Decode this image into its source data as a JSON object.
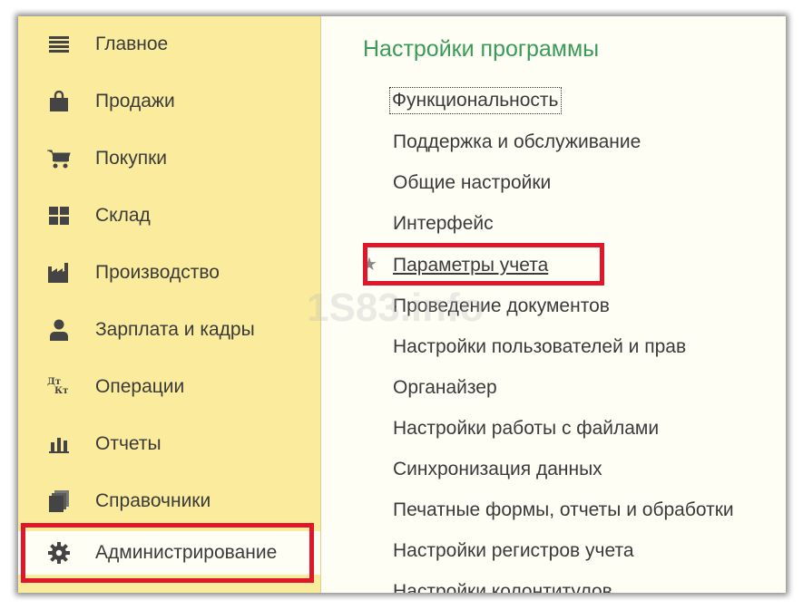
{
  "sidebar": {
    "items": [
      {
        "label": "Главное",
        "icon": "menu-lines-icon"
      },
      {
        "label": "Продажи",
        "icon": "shopping-bag-icon"
      },
      {
        "label": "Покупки",
        "icon": "cart-icon"
      },
      {
        "label": "Склад",
        "icon": "warehouse-grid-icon"
      },
      {
        "label": "Производство",
        "icon": "factory-icon"
      },
      {
        "label": "Зарплата и кадры",
        "icon": "person-icon"
      },
      {
        "label": "Операции",
        "icon": "dt-kt-icon"
      },
      {
        "label": "Отчеты",
        "icon": "bar-chart-icon"
      },
      {
        "label": "Справочники",
        "icon": "documents-icon"
      },
      {
        "label": "Администрирование",
        "icon": "gear-icon",
        "active": true
      }
    ],
    "dt_kt_text": {
      "top": "Дт",
      "bottom": "Кт"
    }
  },
  "main": {
    "title": "Настройки программы",
    "links": [
      "Функциональность",
      "Поддержка и обслуживание",
      "Общие настройки",
      "Интерфейс",
      "Параметры учета",
      "Проведение документов",
      "Настройки пользователей и прав",
      "Органайзер",
      "Настройки работы с файлами",
      "Синхронизация данных",
      "Печатные формы, отчеты и обработки",
      "Настройки регистров учета",
      "Настройки колонтитулов"
    ],
    "favorite_icon": "star-icon"
  },
  "watermark": "1S83.info",
  "colors": {
    "sidebar_bg": "#fbec9d",
    "content_bg": "#fffef5",
    "title_green": "#3b9a57",
    "highlight_red": "#e0172a",
    "text": "#3a3a3a"
  }
}
